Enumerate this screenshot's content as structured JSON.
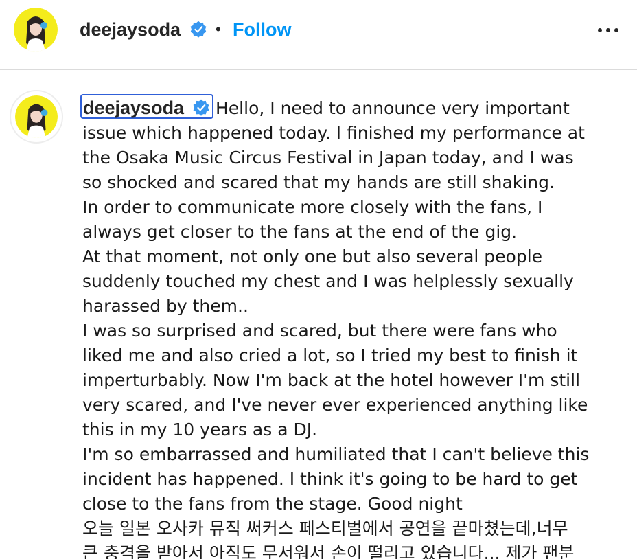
{
  "post_header": {
    "username": "deejaysoda",
    "separator": "•",
    "follow_label": "Follow",
    "more_icon": "more-horizontal-icon",
    "verified_icon": "verified-badge-icon",
    "accent_color": "#0095f6",
    "verified_color": "#3897f0"
  },
  "caption": {
    "username": "deejaysoda",
    "lines": [
      "Hello, I need to announce very important",
      "issue which happened today. I finished my performance at",
      "the Osaka Music Circus Festival in Japan today, and I was",
      "so shocked and scared that my hands are still shaking.",
      "In order to communicate more closely with the fans, I",
      "always get closer to the fans at the end of the gig.",
      "At that moment, not only one but also several people",
      "suddenly touched my chest and I was helplessly sexually",
      "harassed by them..",
      "I was so surprised and scared, but there were fans who",
      "liked me and also cried a lot, so I tried my best to finish it",
      "imperturbably. Now I'm back at the hotel however I'm still",
      "very scared, and I've never ever experienced anything like",
      "this in my 10 years as a DJ.",
      "I'm so embarrassed and humiliated that I can't believe this",
      "incident has happened. I think it's going to be hard to get",
      "close to the fans from the stage. Good night",
      "오늘 일본 오사카 뮤직 써커스 페스티벌에서 공연을 끝마쳤는데,너무",
      "큰 충격을 받아서 아직도 무서워서 손이 떨리고 있습니다... 제가 팬분"
    ]
  }
}
